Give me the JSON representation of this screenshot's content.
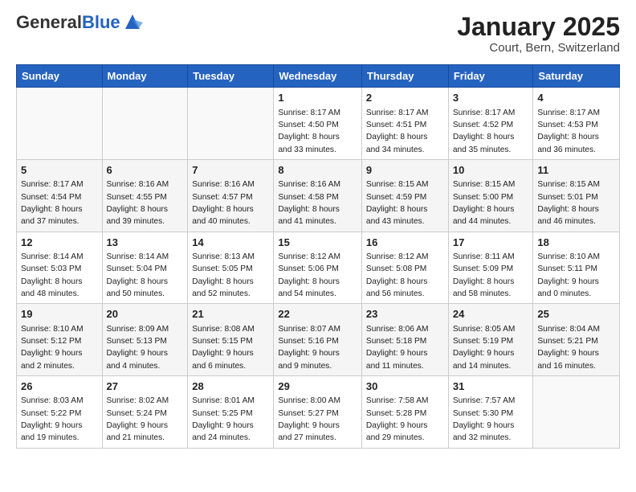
{
  "header": {
    "logo_general": "General",
    "logo_blue": "Blue",
    "title": "January 2025",
    "subtitle": "Court, Bern, Switzerland"
  },
  "weekdays": [
    "Sunday",
    "Monday",
    "Tuesday",
    "Wednesday",
    "Thursday",
    "Friday",
    "Saturday"
  ],
  "weeks": [
    [
      {
        "day": "",
        "info": ""
      },
      {
        "day": "",
        "info": ""
      },
      {
        "day": "",
        "info": ""
      },
      {
        "day": "1",
        "info": "Sunrise: 8:17 AM\nSunset: 4:50 PM\nDaylight: 8 hours\nand 33 minutes."
      },
      {
        "day": "2",
        "info": "Sunrise: 8:17 AM\nSunset: 4:51 PM\nDaylight: 8 hours\nand 34 minutes."
      },
      {
        "day": "3",
        "info": "Sunrise: 8:17 AM\nSunset: 4:52 PM\nDaylight: 8 hours\nand 35 minutes."
      },
      {
        "day": "4",
        "info": "Sunrise: 8:17 AM\nSunset: 4:53 PM\nDaylight: 8 hours\nand 36 minutes."
      }
    ],
    [
      {
        "day": "5",
        "info": "Sunrise: 8:17 AM\nSunset: 4:54 PM\nDaylight: 8 hours\nand 37 minutes."
      },
      {
        "day": "6",
        "info": "Sunrise: 8:16 AM\nSunset: 4:55 PM\nDaylight: 8 hours\nand 39 minutes."
      },
      {
        "day": "7",
        "info": "Sunrise: 8:16 AM\nSunset: 4:57 PM\nDaylight: 8 hours\nand 40 minutes."
      },
      {
        "day": "8",
        "info": "Sunrise: 8:16 AM\nSunset: 4:58 PM\nDaylight: 8 hours\nand 41 minutes."
      },
      {
        "day": "9",
        "info": "Sunrise: 8:15 AM\nSunset: 4:59 PM\nDaylight: 8 hours\nand 43 minutes."
      },
      {
        "day": "10",
        "info": "Sunrise: 8:15 AM\nSunset: 5:00 PM\nDaylight: 8 hours\nand 44 minutes."
      },
      {
        "day": "11",
        "info": "Sunrise: 8:15 AM\nSunset: 5:01 PM\nDaylight: 8 hours\nand 46 minutes."
      }
    ],
    [
      {
        "day": "12",
        "info": "Sunrise: 8:14 AM\nSunset: 5:03 PM\nDaylight: 8 hours\nand 48 minutes."
      },
      {
        "day": "13",
        "info": "Sunrise: 8:14 AM\nSunset: 5:04 PM\nDaylight: 8 hours\nand 50 minutes."
      },
      {
        "day": "14",
        "info": "Sunrise: 8:13 AM\nSunset: 5:05 PM\nDaylight: 8 hours\nand 52 minutes."
      },
      {
        "day": "15",
        "info": "Sunrise: 8:12 AM\nSunset: 5:06 PM\nDaylight: 8 hours\nand 54 minutes."
      },
      {
        "day": "16",
        "info": "Sunrise: 8:12 AM\nSunset: 5:08 PM\nDaylight: 8 hours\nand 56 minutes."
      },
      {
        "day": "17",
        "info": "Sunrise: 8:11 AM\nSunset: 5:09 PM\nDaylight: 8 hours\nand 58 minutes."
      },
      {
        "day": "18",
        "info": "Sunrise: 8:10 AM\nSunset: 5:11 PM\nDaylight: 9 hours\nand 0 minutes."
      }
    ],
    [
      {
        "day": "19",
        "info": "Sunrise: 8:10 AM\nSunset: 5:12 PM\nDaylight: 9 hours\nand 2 minutes."
      },
      {
        "day": "20",
        "info": "Sunrise: 8:09 AM\nSunset: 5:13 PM\nDaylight: 9 hours\nand 4 minutes."
      },
      {
        "day": "21",
        "info": "Sunrise: 8:08 AM\nSunset: 5:15 PM\nDaylight: 9 hours\nand 6 minutes."
      },
      {
        "day": "22",
        "info": "Sunrise: 8:07 AM\nSunset: 5:16 PM\nDaylight: 9 hours\nand 9 minutes."
      },
      {
        "day": "23",
        "info": "Sunrise: 8:06 AM\nSunset: 5:18 PM\nDaylight: 9 hours\nand 11 minutes."
      },
      {
        "day": "24",
        "info": "Sunrise: 8:05 AM\nSunset: 5:19 PM\nDaylight: 9 hours\nand 14 minutes."
      },
      {
        "day": "25",
        "info": "Sunrise: 8:04 AM\nSunset: 5:21 PM\nDaylight: 9 hours\nand 16 minutes."
      }
    ],
    [
      {
        "day": "26",
        "info": "Sunrise: 8:03 AM\nSunset: 5:22 PM\nDaylight: 9 hours\nand 19 minutes."
      },
      {
        "day": "27",
        "info": "Sunrise: 8:02 AM\nSunset: 5:24 PM\nDaylight: 9 hours\nand 21 minutes."
      },
      {
        "day": "28",
        "info": "Sunrise: 8:01 AM\nSunset: 5:25 PM\nDaylight: 9 hours\nand 24 minutes."
      },
      {
        "day": "29",
        "info": "Sunrise: 8:00 AM\nSunset: 5:27 PM\nDaylight: 9 hours\nand 27 minutes."
      },
      {
        "day": "30",
        "info": "Sunrise: 7:58 AM\nSunset: 5:28 PM\nDaylight: 9 hours\nand 29 minutes."
      },
      {
        "day": "31",
        "info": "Sunrise: 7:57 AM\nSunset: 5:30 PM\nDaylight: 9 hours\nand 32 minutes."
      },
      {
        "day": "",
        "info": ""
      }
    ]
  ]
}
